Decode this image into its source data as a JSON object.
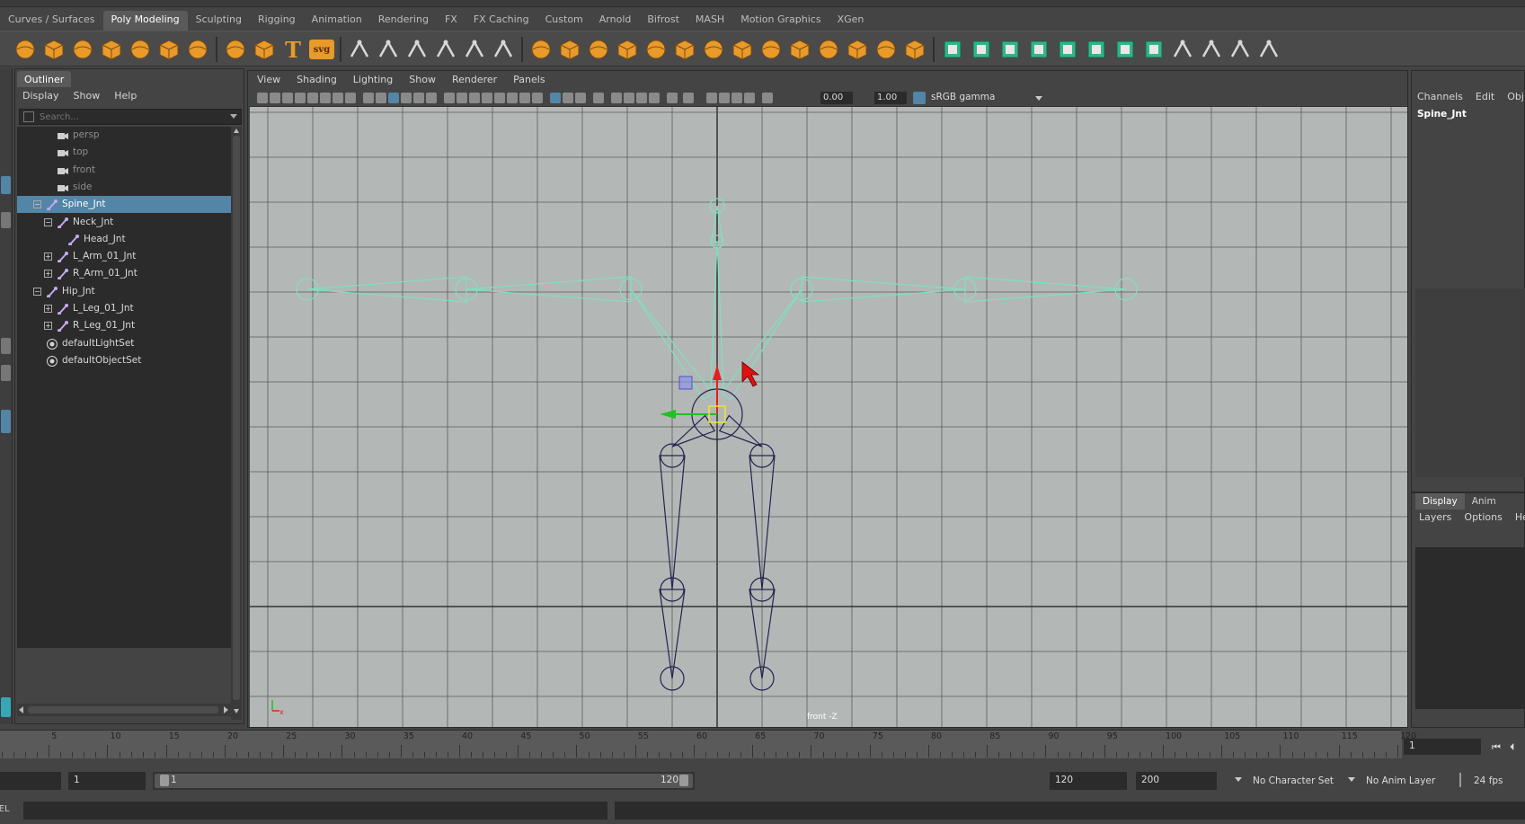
{
  "shelf": {
    "tabs": [
      "Curves / Surfaces",
      "Poly Modeling",
      "Sculpting",
      "Rigging",
      "Animation",
      "Rendering",
      "FX",
      "FX Caching",
      "Custom",
      "Arnold",
      "Bifrost",
      "MASH",
      "Motion Graphics",
      "XGen"
    ],
    "active_tab": "Poly Modeling",
    "text_icon_label": "T",
    "svg_icon_label": "svg"
  },
  "outliner": {
    "title": "Outliner",
    "menu": [
      "Display",
      "Show",
      "Help"
    ],
    "search_placeholder": "Search...",
    "items": [
      {
        "label": "persp",
        "icon": "camera-icon",
        "state": "dim"
      },
      {
        "label": "top",
        "icon": "camera-icon",
        "state": "dim"
      },
      {
        "label": "front",
        "icon": "camera-icon",
        "state": "dim"
      },
      {
        "label": "side",
        "icon": "camera-icon",
        "state": "dim"
      },
      {
        "label": "Spine_Jnt",
        "icon": "joint-icon",
        "state": "selected"
      },
      {
        "label": "Neck_Jnt",
        "icon": "joint-icon",
        "state": "normal"
      },
      {
        "label": "Head_Jnt",
        "icon": "joint-icon",
        "state": "normal"
      },
      {
        "label": "L_Arm_01_Jnt",
        "icon": "joint-icon",
        "state": "normal"
      },
      {
        "label": "R_Arm_01_Jnt",
        "icon": "joint-icon",
        "state": "normal"
      },
      {
        "label": "Hip_Jnt",
        "icon": "joint-icon",
        "state": "normal"
      },
      {
        "label": "L_Leg_01_Jnt",
        "icon": "joint-icon",
        "state": "normal"
      },
      {
        "label": "R_Leg_01_Jnt",
        "icon": "joint-icon",
        "state": "normal"
      },
      {
        "label": "defaultLightSet",
        "icon": "set-icon",
        "state": "normal"
      },
      {
        "label": "defaultObjectSet",
        "icon": "set-icon",
        "state": "normal"
      }
    ]
  },
  "viewport": {
    "menu": [
      "View",
      "Shading",
      "Lighting",
      "Show",
      "Renderer",
      "Panels"
    ],
    "exposure": "0.00",
    "gamma": "1.00",
    "color_space": "sRGB gamma",
    "camera_label": "front -Z",
    "axis_x_label": "x"
  },
  "channel_box": {
    "menu": [
      "Channels",
      "Edit",
      "Obj"
    ],
    "selected_node": "Spine_Jnt"
  },
  "layer_editor": {
    "tabs": [
      "Display",
      "Anim"
    ],
    "active_tab": "Display",
    "menu": [
      "Layers",
      "Options",
      "He"
    ]
  },
  "timeline": {
    "ticks": [
      "5",
      "10",
      "15",
      "20",
      "25",
      "30",
      "35",
      "40",
      "45",
      "50",
      "55",
      "60",
      "65",
      "70",
      "75",
      "80",
      "85",
      "90",
      "95",
      "100",
      "105",
      "110",
      "115",
      "120"
    ],
    "current_frame": "1"
  },
  "range": {
    "start_field": "",
    "min_field": "1",
    "slider_start": "1",
    "slider_end": "120",
    "end_field": "120",
    "max_field": "200",
    "character_set": "No Character Set",
    "anim_layer": "No Anim Layer",
    "fps": "24 fps"
  },
  "command_line": {
    "language_label": "MEL"
  },
  "colors": {
    "selection_blue": "#5285a6",
    "joint_selected": "#7fe0c0",
    "joint_unselected": "#2a2050",
    "viewport_bg": "#b3b8b6",
    "shelf_icon_orange": "#e89a2a"
  }
}
